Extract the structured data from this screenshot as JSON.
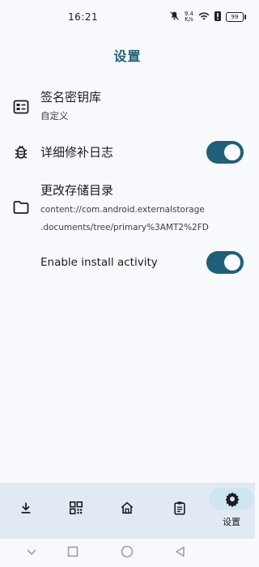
{
  "status_bar": {
    "time": "16:21",
    "net_speed_value": "9.4",
    "net_speed_unit": "K/s",
    "battery": "99"
  },
  "page": {
    "title": "设置"
  },
  "settings": {
    "keystore": {
      "title": "签名密钥库",
      "subtitle": "自定义"
    },
    "verbose_log": {
      "title": "详细修补日志",
      "enabled": true
    },
    "storage_dir": {
      "title": "更改存储目录",
      "path_line1": "content://com.android.externalstorage",
      "path_line2": ".documents/tree/primary%3AMT2%2FD"
    },
    "install_activity": {
      "title": "Enable install activity",
      "enabled": true
    }
  },
  "bottom_nav": {
    "items": [
      {
        "icon": "download-icon"
      },
      {
        "icon": "grid-icon"
      },
      {
        "icon": "home-icon"
      },
      {
        "icon": "clipboard-icon"
      },
      {
        "icon": "gear-icon",
        "label": "设置",
        "active": true
      }
    ]
  },
  "colors": {
    "accent": "#1f5f7a",
    "nav_background": "#e1eaf2",
    "active_pill": "#cfe6f2"
  }
}
